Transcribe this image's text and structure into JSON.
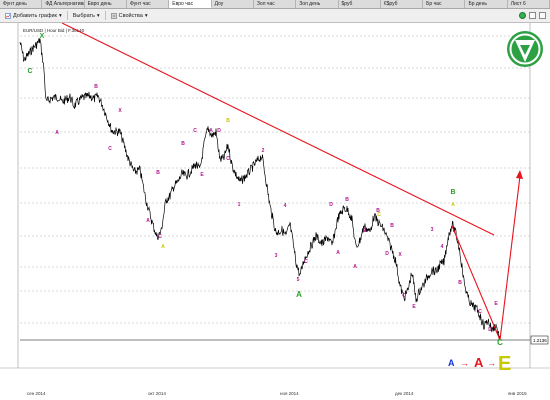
{
  "tabs": [
    {
      "label": "Фунт день",
      "active": false
    },
    {
      "label": "ФД Альтернатива",
      "active": false
    },
    {
      "label": "Евро день",
      "active": false
    },
    {
      "label": "Фунт час",
      "active": false
    },
    {
      "label": "Евро час",
      "active": true
    },
    {
      "label": "Доу",
      "active": false
    },
    {
      "label": "Зол час",
      "active": false
    },
    {
      "label": "Зол день",
      "active": false
    },
    {
      "label": "$руб",
      "active": false
    },
    {
      "label": "€$руб",
      "active": false
    },
    {
      "label": "Бр час",
      "active": false
    },
    {
      "label": "Бр день",
      "active": false
    },
    {
      "label": "Лист 6",
      "active": false
    }
  ],
  "toolbar": {
    "add_chart": "Добавить график",
    "select": "Выбрать",
    "properties": "Свойства"
  },
  "chart": {
    "symbol_label": "EUR/USD | Hour Bid | F.36140",
    "price_label": "1.2136",
    "x_ticks": [
      "сен 2014",
      "окт 2014",
      "ноя 2014",
      "дек 2014",
      "янв 2015"
    ],
    "bottom_sequence": {
      "a": "A",
      "b": "A",
      "c": "E",
      "arrow": "→"
    },
    "colors": {
      "price": "#000000",
      "trendline": "#e8141e",
      "wave_minor": "#b0148c",
      "wave_major": "#2aa02a",
      "wave_yellow": "#c8c800",
      "grid": "#b4b4b4",
      "blue": "#1432dc",
      "logo": "#2da043"
    }
  },
  "wave_labels": [
    {
      "text": "X",
      "color": "green"
    },
    {
      "text": "C",
      "color": "green"
    },
    {
      "text": "B",
      "color": "magenta"
    },
    {
      "text": "A",
      "color": "magenta"
    },
    {
      "text": "X",
      "color": "magenta"
    },
    {
      "text": "C",
      "color": "magenta"
    },
    {
      "text": "B",
      "color": "magenta"
    },
    {
      "text": "A",
      "color": "magenta"
    },
    {
      "text": "C",
      "color": "magenta"
    },
    {
      "text": "A",
      "color": "yellow"
    },
    {
      "text": "A",
      "color": "magenta"
    },
    {
      "text": "B",
      "color": "magenta"
    },
    {
      "text": "C",
      "color": "magenta"
    },
    {
      "text": "E",
      "color": "magenta"
    },
    {
      "text": "D",
      "color": "magenta"
    },
    {
      "text": "B",
      "color": "yellow"
    },
    {
      "text": "C",
      "color": "magenta"
    },
    {
      "text": "2",
      "color": "magenta"
    },
    {
      "text": "1",
      "color": "magenta"
    },
    {
      "text": "4",
      "color": "magenta"
    },
    {
      "text": "3",
      "color": "magenta"
    },
    {
      "text": "5",
      "color": "magenta"
    },
    {
      "text": "A",
      "color": "green"
    },
    {
      "text": "B",
      "color": "magenta"
    },
    {
      "text": "A",
      "color": "magenta"
    },
    {
      "text": "C",
      "color": "magenta"
    },
    {
      "text": "D",
      "color": "magenta"
    },
    {
      "text": "B",
      "color": "magenta"
    },
    {
      "text": "C",
      "color": "yellow"
    },
    {
      "text": "E",
      "color": "magenta"
    },
    {
      "text": "A",
      "color": "magenta"
    },
    {
      "text": "D",
      "color": "magenta"
    },
    {
      "text": "B",
      "color": "magenta"
    },
    {
      "text": "X",
      "color": "magenta"
    },
    {
      "text": "C",
      "color": "magenta"
    },
    {
      "text": "E",
      "color": "magenta"
    },
    {
      "text": "3",
      "color": "magenta"
    },
    {
      "text": "4",
      "color": "magenta"
    },
    {
      "text": "B",
      "color": "green"
    },
    {
      "text": "A",
      "color": "yellow"
    },
    {
      "text": "B",
      "color": "magenta"
    },
    {
      "text": "C",
      "color": "magenta"
    },
    {
      "text": "E",
      "color": "magenta"
    },
    {
      "text": "D",
      "color": "magenta"
    },
    {
      "text": "C",
      "color": "green"
    }
  ]
}
